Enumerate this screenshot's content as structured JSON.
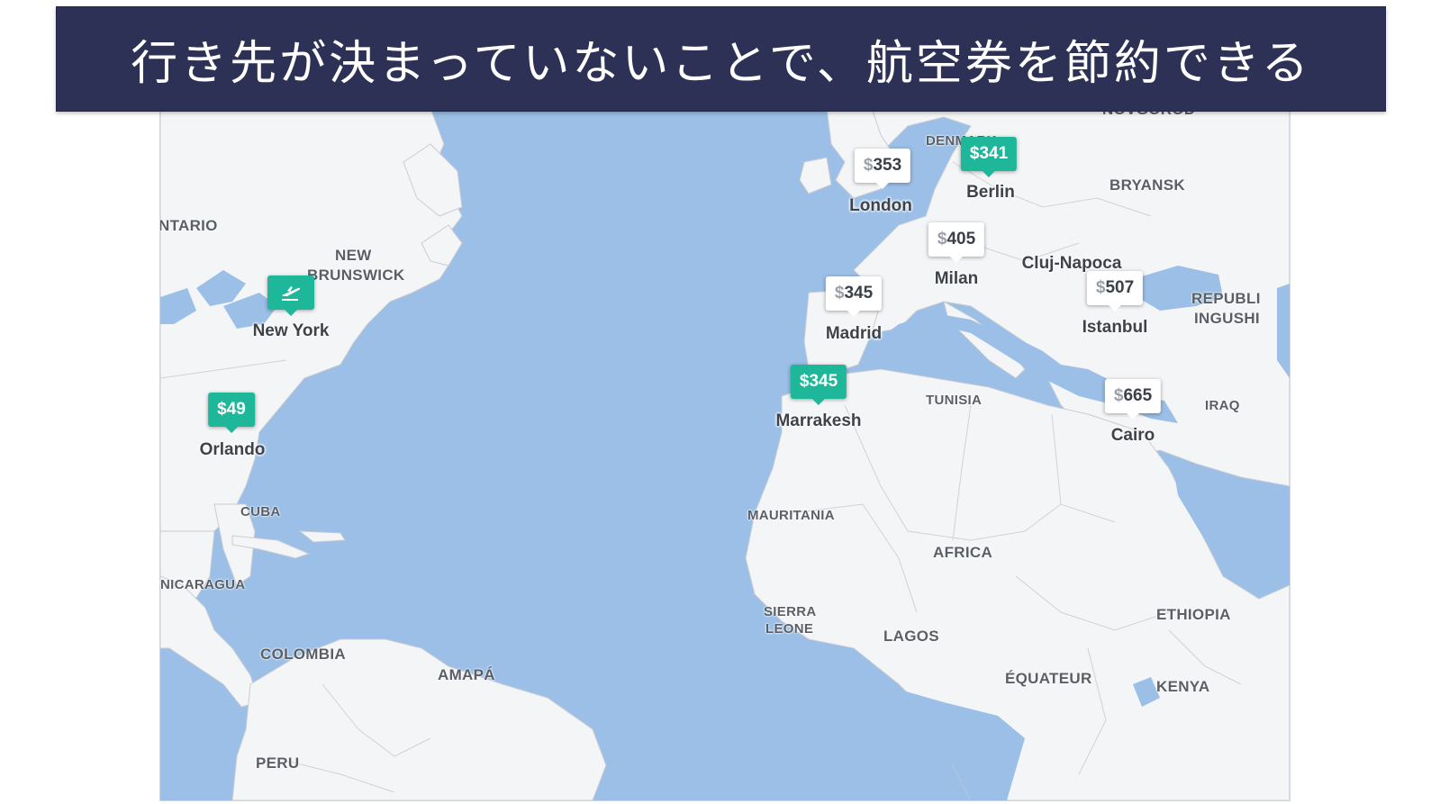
{
  "banner": {
    "title": "行き先が決まっていないことで、航空券を節約できる"
  },
  "map": {
    "regions": {
      "ontario": "NTARIO",
      "new_brunswick_1": "NEW",
      "new_brunswick_2": "BRUNSWICK",
      "cuba": "CUBA",
      "nicaragua": "NICARAGUA",
      "colombia": "COLOMBIA",
      "amapa": "AMAPÁ",
      "peru": "PERU",
      "denmark": "DENMARK",
      "bryansk": "BRYANSK",
      "novgorod": "NOVGOROD",
      "republic_1": "REPUBLI",
      "republic_2": "INGUSHI",
      "tunisia": "TUNISIA",
      "iraq": "IRAQ",
      "mauritania": "MAURITANIA",
      "africa": "AFRICA",
      "sierra_1": "SIERRA",
      "sierra_2": "LEONE",
      "lagos": "LAGOS",
      "equateur": "ÉQUATEUR",
      "ethiopia": "ETHIOPIA",
      "kenya": "KENYA",
      "cluj": "Cluj-Napoca"
    },
    "pins": {
      "london": {
        "city": "London",
        "currency": "$",
        "amount": "353"
      },
      "berlin": {
        "city": "Berlin",
        "currency": "$",
        "amount": "341"
      },
      "milan": {
        "city": "Milan",
        "currency": "$",
        "amount": "405"
      },
      "madrid": {
        "city": "Madrid",
        "currency": "$",
        "amount": "345"
      },
      "istanbul": {
        "city": "Istanbul",
        "currency": "$",
        "amount": "507"
      },
      "marrakesh": {
        "city": "Marrakesh",
        "currency": "$",
        "amount": "345"
      },
      "cairo": {
        "city": "Cairo",
        "currency": "$",
        "amount": "665"
      },
      "orlando": {
        "city": "Orlando",
        "currency": "$",
        "amount": "49"
      },
      "newyork": {
        "city": "New York",
        "icon": "plane-departure-icon"
      }
    },
    "colors": {
      "ocean": "#9bbfe6",
      "land": "#f4f5f7",
      "pin_green": "#1fb79a",
      "banner": "#2e3156"
    }
  }
}
